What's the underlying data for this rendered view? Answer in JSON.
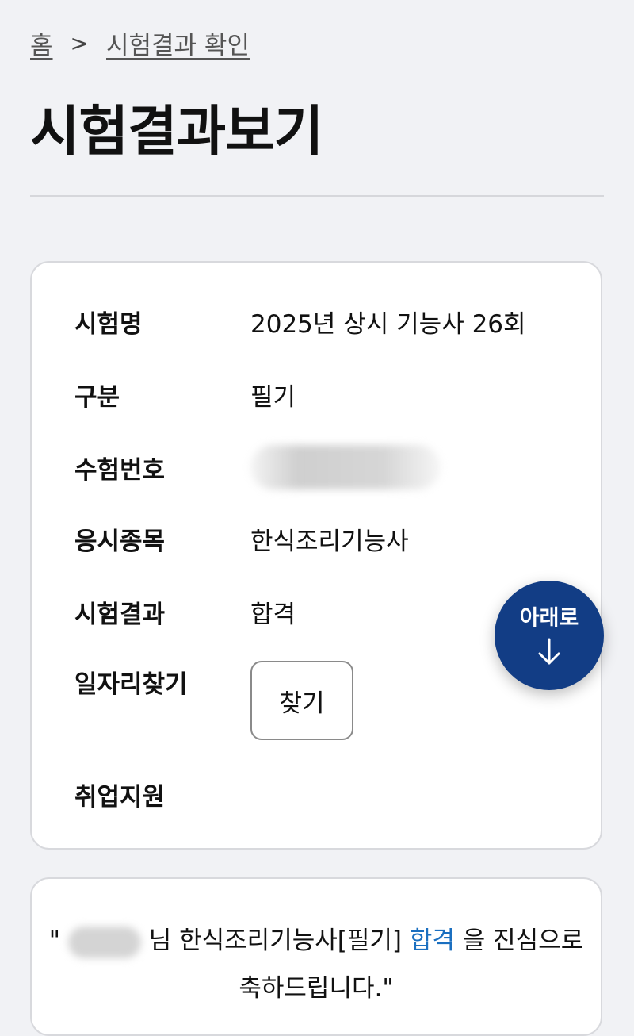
{
  "breadcrumb": {
    "home": "홈",
    "separator": ">",
    "current": "시험결과 확인"
  },
  "page_title": "시험결과보기",
  "info": {
    "rows": [
      {
        "label": "시험명",
        "value": "2025년 상시 기능사 26회"
      },
      {
        "label": "구분",
        "value": "필기"
      },
      {
        "label": "수험번호",
        "value": ""
      },
      {
        "label": "응시종목",
        "value": "한식조리기능사"
      },
      {
        "label": "시험결과",
        "value": "합격"
      },
      {
        "label": "일자리찾기",
        "button": "찾기"
      },
      {
        "label": "취업지원",
        "value": ""
      }
    ]
  },
  "message": {
    "open_quote": "\"",
    "before": "님 한식조리기능사[필기]",
    "highlight": "합격",
    "after": "을 진심으로 축하드립니다.\""
  },
  "fab": {
    "label": "아래로",
    "icon": "arrow-down-icon"
  },
  "colors": {
    "accent": "#123d85",
    "pass_text": "#1a6fc0",
    "background": "#f1f2f5"
  }
}
